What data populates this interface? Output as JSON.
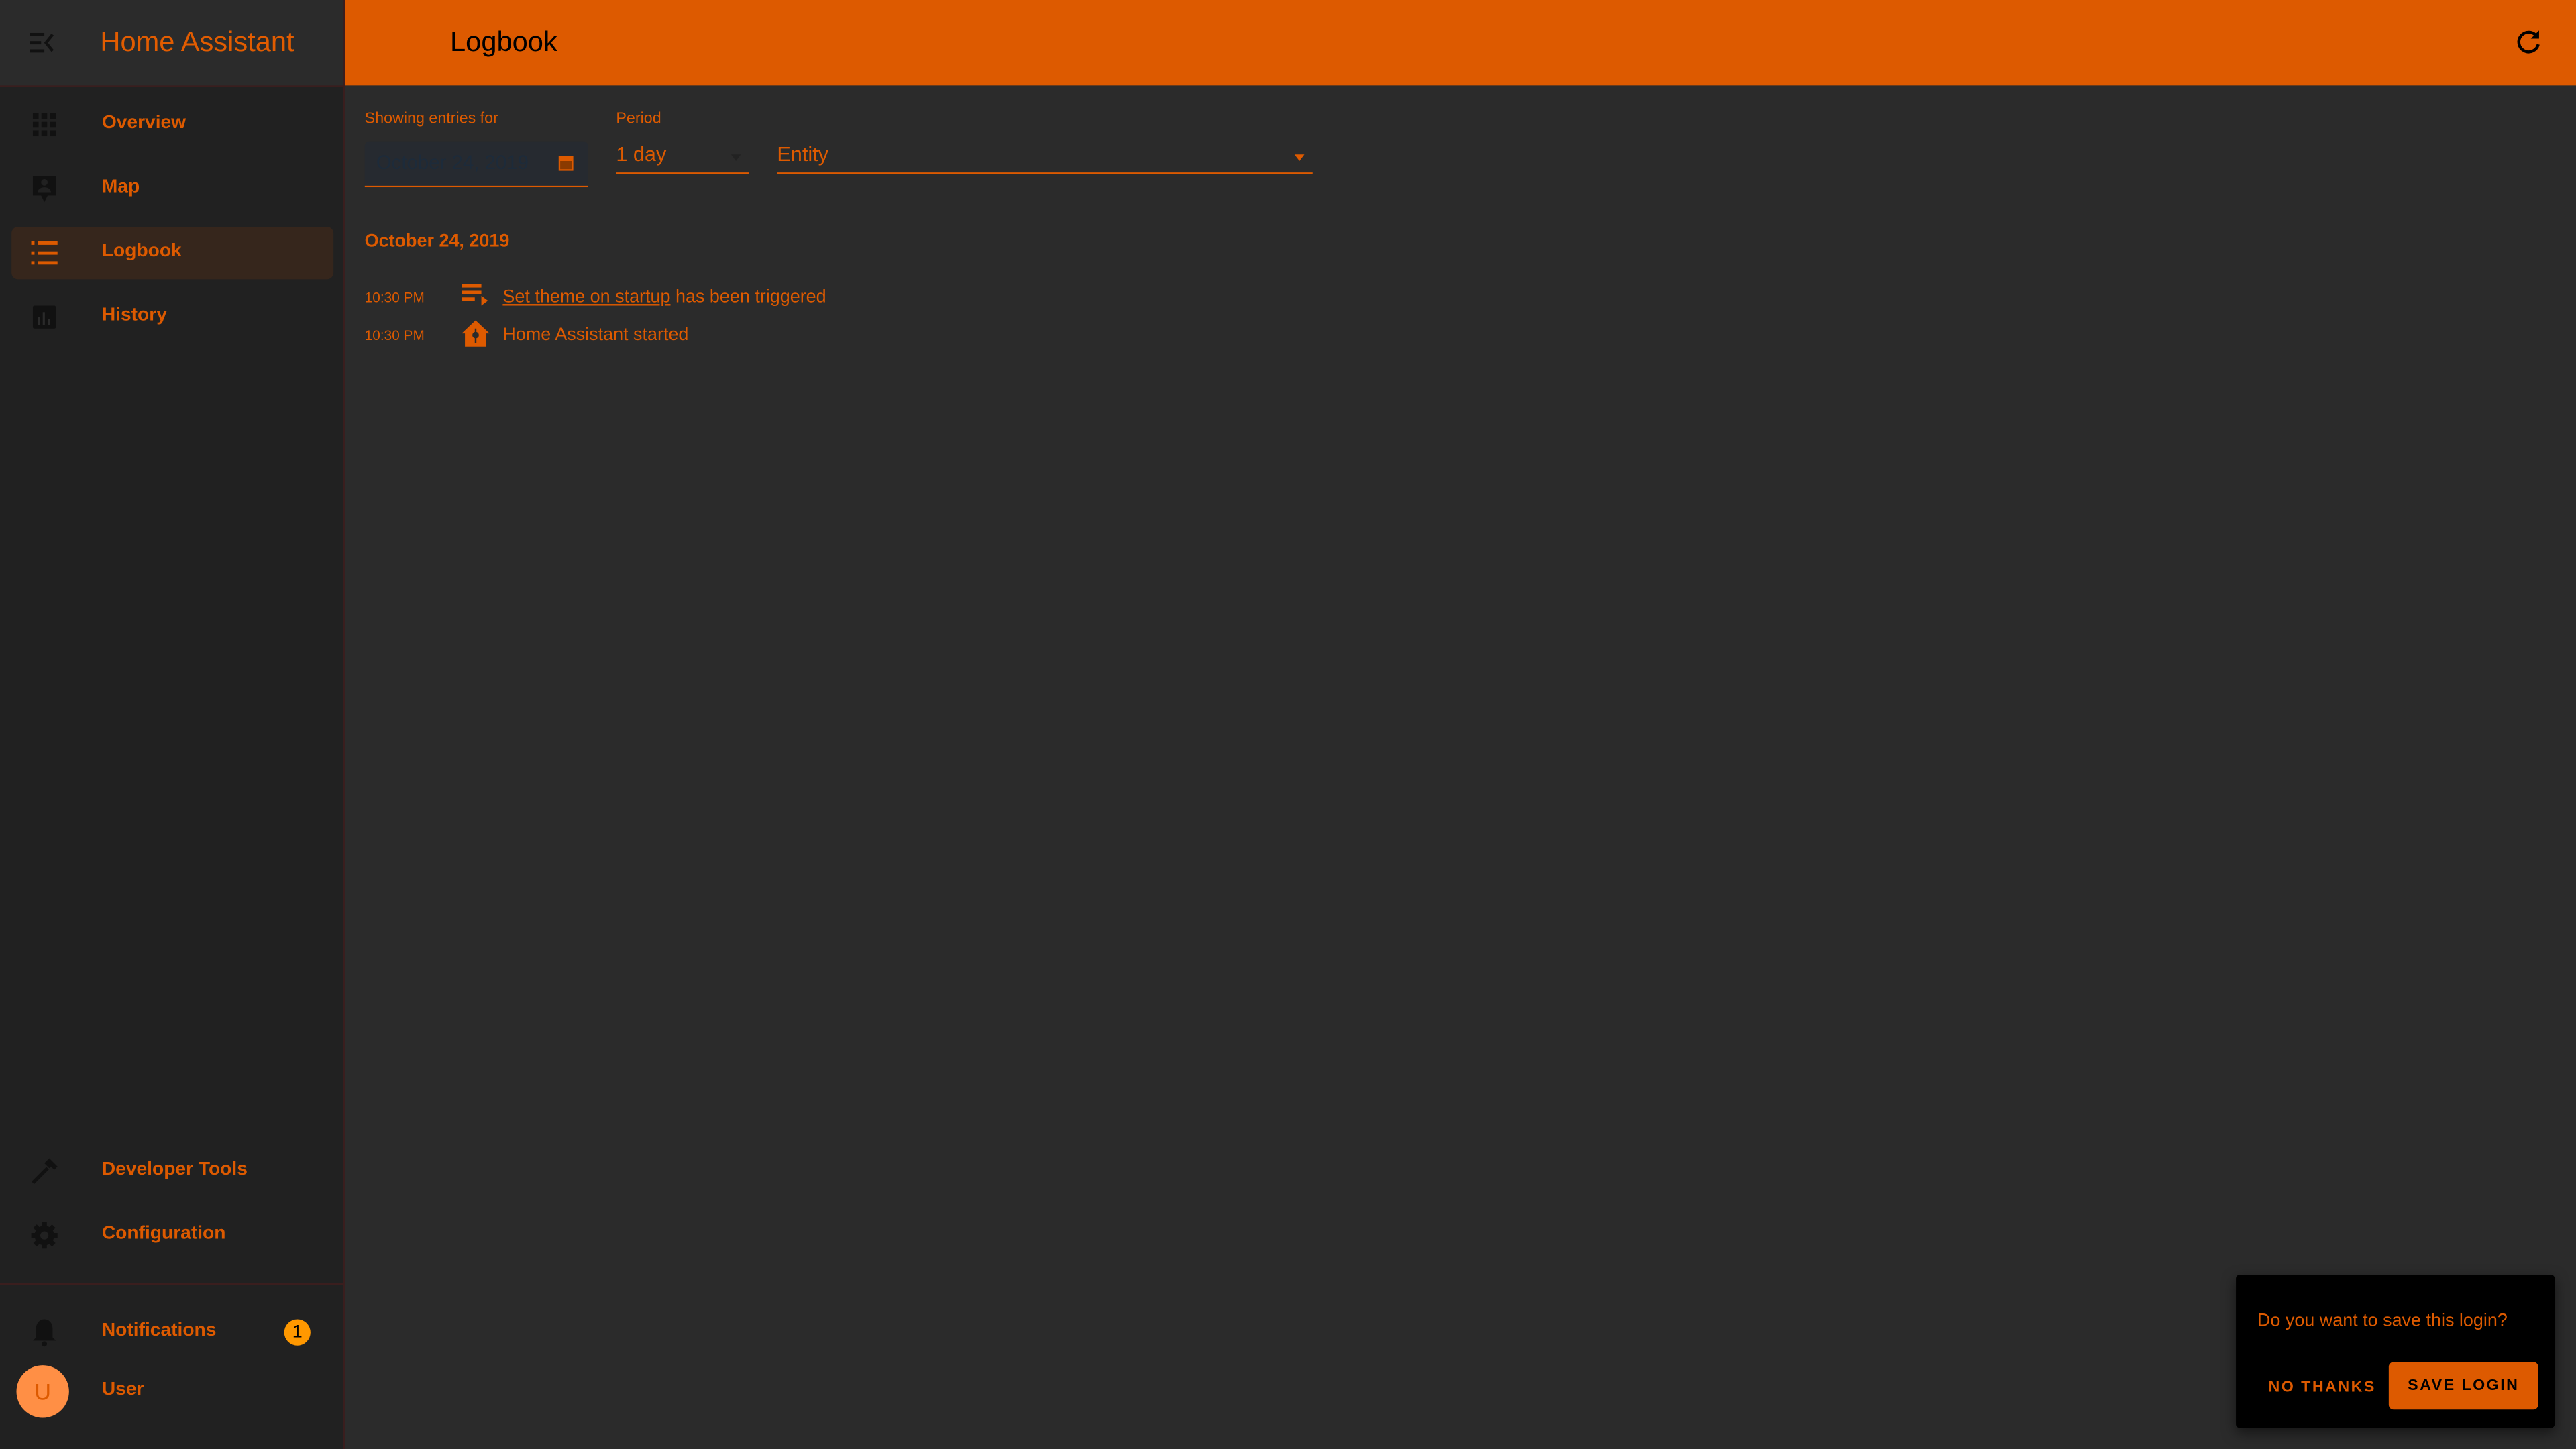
{
  "colors": {
    "accent": "#dd5a00",
    "header_bg": "#dd5a00",
    "sidebar_bg": "#212121",
    "main_bg": "#2b2b2b",
    "badge": "#ff9800",
    "avatar": "#ff8f45"
  },
  "sidebar": {
    "title": "Home Assistant",
    "items": [
      {
        "label": "Overview",
        "icon": "view-dashboard-icon"
      },
      {
        "label": "Map",
        "icon": "map-account-icon"
      },
      {
        "label": "Logbook",
        "icon": "format-list-bulleted-icon",
        "active": true
      },
      {
        "label": "History",
        "icon": "chart-box-icon"
      }
    ],
    "bottom_items": [
      {
        "label": "Developer Tools",
        "icon": "hammer-icon"
      },
      {
        "label": "Configuration",
        "icon": "gear-icon"
      }
    ],
    "notifications": {
      "label": "Notifications",
      "count": "1"
    },
    "user": {
      "label": "User",
      "initial": "U"
    }
  },
  "header": {
    "title": "Logbook",
    "refresh_icon": "refresh-icon"
  },
  "filters": {
    "date_label": "Showing entries for",
    "date_value": "October 24, 2019",
    "period_label": "Period",
    "period_value": "1 day",
    "entity_placeholder": "Entity"
  },
  "log": {
    "day": "October 24, 2019",
    "entries": [
      {
        "time": "10:30 PM",
        "icon": "playlist-play-icon",
        "link": "Set theme on startup",
        "text": " has been triggered"
      },
      {
        "time": "10:30 PM",
        "icon": "home-assistant-icon",
        "link": "",
        "text": "Home Assistant started"
      }
    ]
  },
  "toast": {
    "question": "Do you want to save this login?",
    "no_label": "NO THANKS",
    "yes_label": "SAVE LOGIN"
  }
}
